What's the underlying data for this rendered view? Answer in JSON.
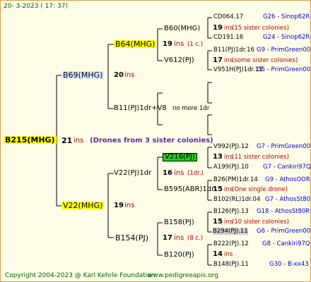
{
  "header": {
    "date": "20-  3-2023 ( 17: 37)"
  },
  "footer": {
    "copyright": "Copyright 2004-2023 @ Karl Kehrle Foundation",
    "site": "www.pedigreeapis.org"
  },
  "colors": {
    "highlight_yellow": "#ffff00",
    "highlight_green": "#22cc22",
    "highlight_gray": "#cccccc",
    "highlight_lightblue": "#dde8ff",
    "line": "#000000",
    "ins_red": "#aa0000",
    "link_blue": "#0000cc"
  },
  "root": {
    "name": "B215(MHG)",
    "ins": "21",
    "ins_word": "ins",
    "note": "(Drones from 3 sister colonies)"
  },
  "gen1": [
    {
      "name": "B69(MHG)",
      "ins": "20",
      "ins_word": "ins"
    },
    {
      "name": "V22(MHG)",
      "ins": "19",
      "ins_word": "ins"
    }
  ],
  "gen2": [
    {
      "name": "B64(MHG)",
      "ins": "19",
      "ins_word": "ins",
      "sub": "(1 c.)"
    },
    {
      "name": "B11(PJ)1dr+V8",
      "extra": "no more 1dr"
    },
    {
      "name": "V22(PJ)1dr",
      "ins": "16",
      "ins_word": "ins",
      "sub": "(1dr.)"
    },
    {
      "name": "B154(PJ)",
      "ins": "17",
      "ins_word": "ins",
      "sub": "(8 c.)"
    }
  ],
  "gen3": [
    {
      "name": "B60(MHG)",
      "ins": "19",
      "ins_word": "ins",
      "sub": "(15 sister colonies)"
    },
    {
      "name": "V612(PJ)",
      "ins": "17",
      "ins_word": "ins",
      "sub": "(some sister colonies)"
    },
    {
      "name": "V216(PJ)",
      "ins": "13",
      "ins_word": "ins",
      "sub": "(11 sister colonies)"
    },
    {
      "name": "B595(ABR)1dr",
      "ins": "15",
      "ins_word": "ins",
      "sub": "(One single drone)"
    },
    {
      "name": "B158(PJ)",
      "ins": "15",
      "ins_word": "ins",
      "sub": "(10 sister colonies)"
    },
    {
      "name": "B120(PJ)",
      "ins": "14",
      "ins_word": "ins"
    }
  ],
  "gen4": [
    {
      "name": "CD064.17",
      "link": "G26 - Sinop62R"
    },
    {
      "name": "CD191.16",
      "link": "G24 - Sinop62R"
    },
    {
      "name": "B11(PJ)1dr.16",
      "link": "G9 - PrimGreen00"
    },
    {
      "name": "V951H(PJ)1dr.15",
      "link": "G5 - PrimGreen00"
    },
    {
      "name": "V992(PJ).12",
      "link": "G7 - PrimGreen00"
    },
    {
      "name": "A199(PJ).10",
      "link": "G7 - Cankiri97Q"
    },
    {
      "name": "B26(PM)1dr.14",
      "link": "G9 - AthosOOR"
    },
    {
      "name": "B102(RL)1dr.04",
      "link": "G7 - AthosSt80R"
    },
    {
      "name": "B126(PJ).13",
      "link": "G18 - AthosSt80R"
    },
    {
      "name": "B294(PJ).11",
      "link": "G6 - PrimGreen00"
    },
    {
      "name": "B222(PJ).12",
      "link": "G8 - Cankiri97Q"
    },
    {
      "name": "B148(PJ).11",
      "link": "G30 - B-xx43"
    }
  ]
}
